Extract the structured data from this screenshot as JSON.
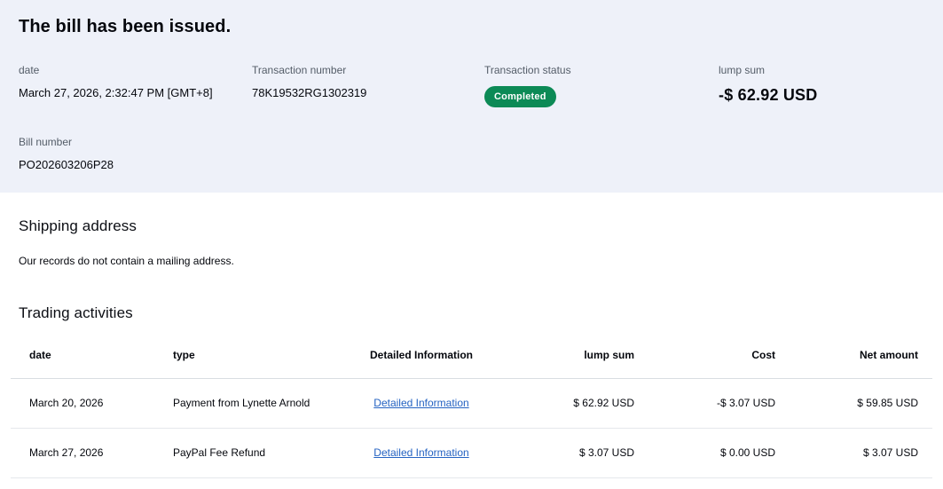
{
  "header": {
    "title": "The bill has been issued.",
    "fields": [
      {
        "label": "date",
        "value": "March 27, 2026, 2:32:47 PM [GMT+8]"
      },
      {
        "label": "Transaction number",
        "value": "78K19532RG1302319"
      },
      {
        "label": "Transaction status",
        "badge": "Completed"
      },
      {
        "label": "lump sum",
        "amount": "-$ 62.92 USD"
      },
      {
        "label": "Bill number",
        "value": "PO202603206P28"
      }
    ],
    "colors": {
      "section_background": "#eef1f9",
      "badge_background": "#0c8a56",
      "badge_text": "#ffffff"
    }
  },
  "shipping": {
    "title": "Shipping address",
    "message": "Our records do not contain a mailing address."
  },
  "activities": {
    "title": "Trading activities",
    "columns": [
      "date",
      "type",
      "Detailed Information",
      "lump sum",
      "Cost",
      "Net amount"
    ],
    "rows": [
      {
        "date": "March 20, 2026",
        "type": "Payment from Lynette Arnold",
        "link": "Detailed Information",
        "lump_sum": "$ 62.92 USD",
        "cost": "-$ 3.07 USD",
        "net": "$ 59.85 USD"
      },
      {
        "date": "March 27, 2026",
        "type": "PayPal Fee Refund",
        "link": "Detailed Information",
        "lump_sum": "$ 3.07 USD",
        "cost": "$ 0.00 USD",
        "net": "$ 3.07 USD"
      }
    ],
    "link_color": "#2563c2"
  }
}
